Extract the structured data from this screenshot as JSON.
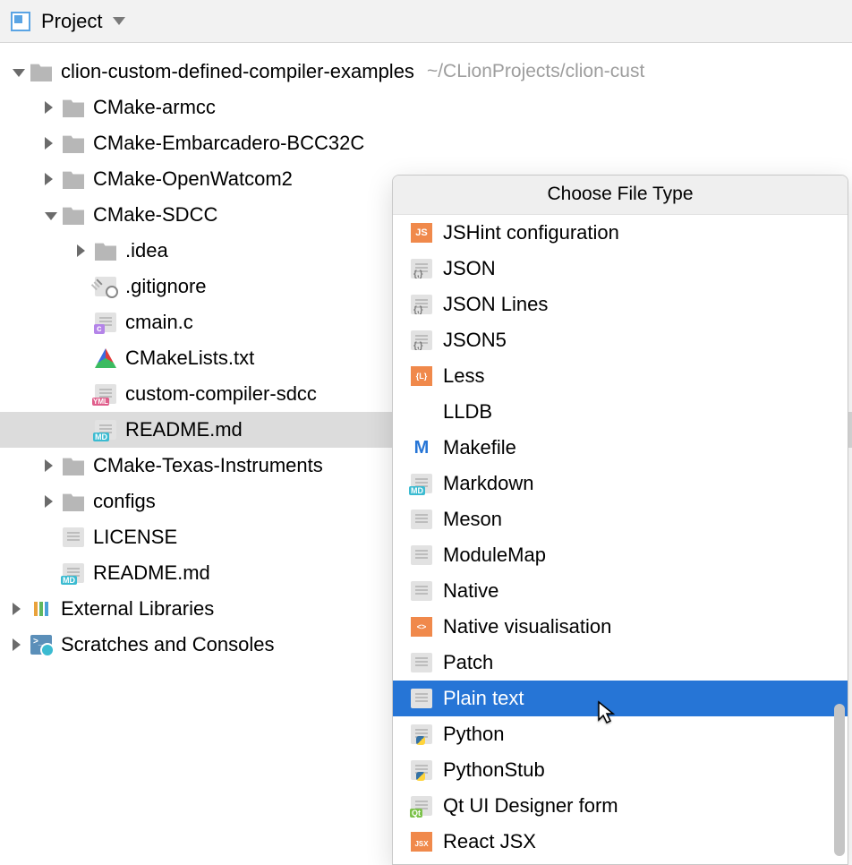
{
  "toolbar": {
    "title": "Project"
  },
  "tree": {
    "root": {
      "name": "clion-custom-defined-compiler-examples",
      "path": "~/CLionProjects/clion-cust",
      "children": [
        {
          "name": "CMake-armcc"
        },
        {
          "name": "CMake-Embarcadero-BCC32C"
        },
        {
          "name": "CMake-OpenWatcom2"
        },
        {
          "name": "CMake-SDCC",
          "children": [
            {
              "name": ".idea"
            },
            {
              "name": ".gitignore"
            },
            {
              "name": "cmain.c"
            },
            {
              "name": "CMakeLists.txt"
            },
            {
              "name": "custom-compiler-sdcc"
            },
            {
              "name": "README.md"
            }
          ]
        },
        {
          "name": "CMake-Texas-Instruments"
        },
        {
          "name": "configs"
        },
        {
          "name": "LICENSE"
        },
        {
          "name": "README.md"
        }
      ]
    },
    "external": "External Libraries",
    "scratches": "Scratches and Consoles"
  },
  "popup": {
    "title": "Choose File Type",
    "items": [
      "JSHint configuration",
      "JSON",
      "JSON Lines",
      "JSON5",
      "Less",
      "LLDB",
      "Makefile",
      "Markdown",
      "Meson",
      "ModuleMap",
      "Native",
      "Native visualisation",
      "Patch",
      "Plain text",
      "Python",
      "PythonStub",
      "Qt UI Designer form",
      "React JSX"
    ],
    "selected": "Plain text"
  }
}
